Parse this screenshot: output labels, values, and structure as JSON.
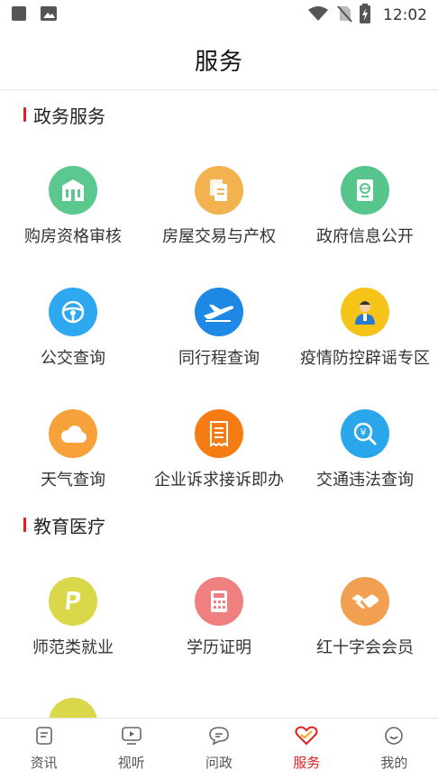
{
  "status_bar": {
    "time": "12:02",
    "icons": [
      "notification-square-icon",
      "image-icon",
      "wifi-icon",
      "no-sim-icon",
      "battery-charging-icon"
    ]
  },
  "header": {
    "title": "服务"
  },
  "sections": [
    {
      "title": "政务服务",
      "items": [
        {
          "label": "购房资格审核",
          "icon": "building-icon",
          "color": "#5bc88d"
        },
        {
          "label": "房屋交易与产权",
          "icon": "documents-icon",
          "color": "#f1b24f"
        },
        {
          "label": "政府信息公开",
          "icon": "passport-icon",
          "color": "#56c68c"
        },
        {
          "label": "公交查询",
          "icon": "steering-wheel-icon",
          "color": "#2ea8ee"
        },
        {
          "label": "同行程查询",
          "icon": "airplane-icon",
          "color": "#1e88e5"
        },
        {
          "label": "疫情防控辟谣专区",
          "icon": "person-icon",
          "color": "#f6c419"
        },
        {
          "label": "天气查询",
          "icon": "cloud-icon",
          "color": "#f7a13a"
        },
        {
          "label": "企业诉求接诉即办",
          "icon": "receipt-icon",
          "color": "#f57c12"
        },
        {
          "label": "交通违法查询",
          "icon": "fine-search-icon",
          "color": "#2aa6ea"
        }
      ]
    },
    {
      "title": "教育医疗",
      "items": [
        {
          "label": "师范类就业",
          "icon": "paypal-icon",
          "color": "#d8d84a"
        },
        {
          "label": "学历证明",
          "icon": "calculator-icon",
          "color": "#f07f7f"
        },
        {
          "label": "红十字会会员",
          "icon": "handshake-icon",
          "color": "#f0a050"
        },
        {
          "label": "",
          "icon": "partial-icon",
          "color": "#d8d84a"
        }
      ]
    }
  ],
  "tabbar": {
    "items": [
      {
        "label": "资讯",
        "icon": "news-icon",
        "active": false
      },
      {
        "label": "视听",
        "icon": "video-icon",
        "active": false
      },
      {
        "label": "问政",
        "icon": "chat-icon",
        "active": false
      },
      {
        "label": "服务",
        "icon": "service-heart-icon",
        "active": true
      },
      {
        "label": "我的",
        "icon": "smile-icon",
        "active": false
      }
    ],
    "active_color": "#e02020"
  }
}
